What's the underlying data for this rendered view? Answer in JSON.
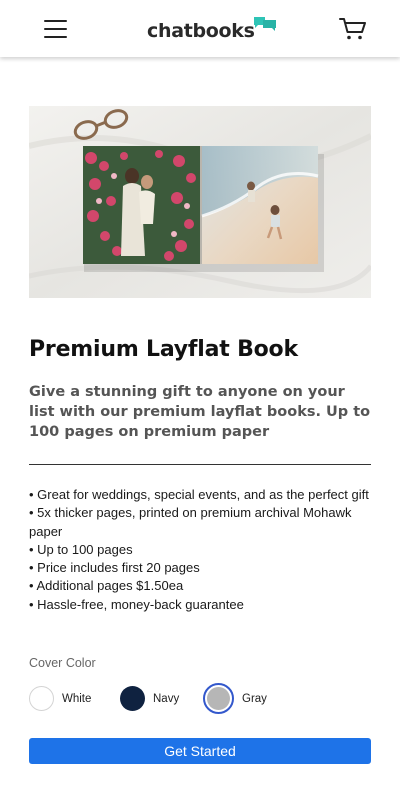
{
  "header": {
    "logo_text": "chatbooks",
    "brand_color": "#2ec4b6"
  },
  "product": {
    "title": "Premium Layflat Book",
    "subtitle": "Give a stunning gift to anyone on your list with our premium layflat books. Up to 100 pages on premium paper",
    "features": [
      "• Great for weddings, special events, and as the perfect gift",
      "• 5x thicker pages, printed on premium archival Mohawk paper",
      "• Up to 100 pages",
      "• Price includes first 20 pages",
      "• Additional pages $1.50ea",
      "• Hassle-free, money-back guarantee"
    ]
  },
  "cover": {
    "label": "Cover Color",
    "options": [
      {
        "label": "White",
        "color": "#ffffff"
      },
      {
        "label": "Navy",
        "color": "#0f2240"
      },
      {
        "label": "Gray",
        "color": "#b6b6b6",
        "selected": true
      }
    ]
  },
  "cta": {
    "label": "Get Started",
    "color": "#1e73e8"
  }
}
